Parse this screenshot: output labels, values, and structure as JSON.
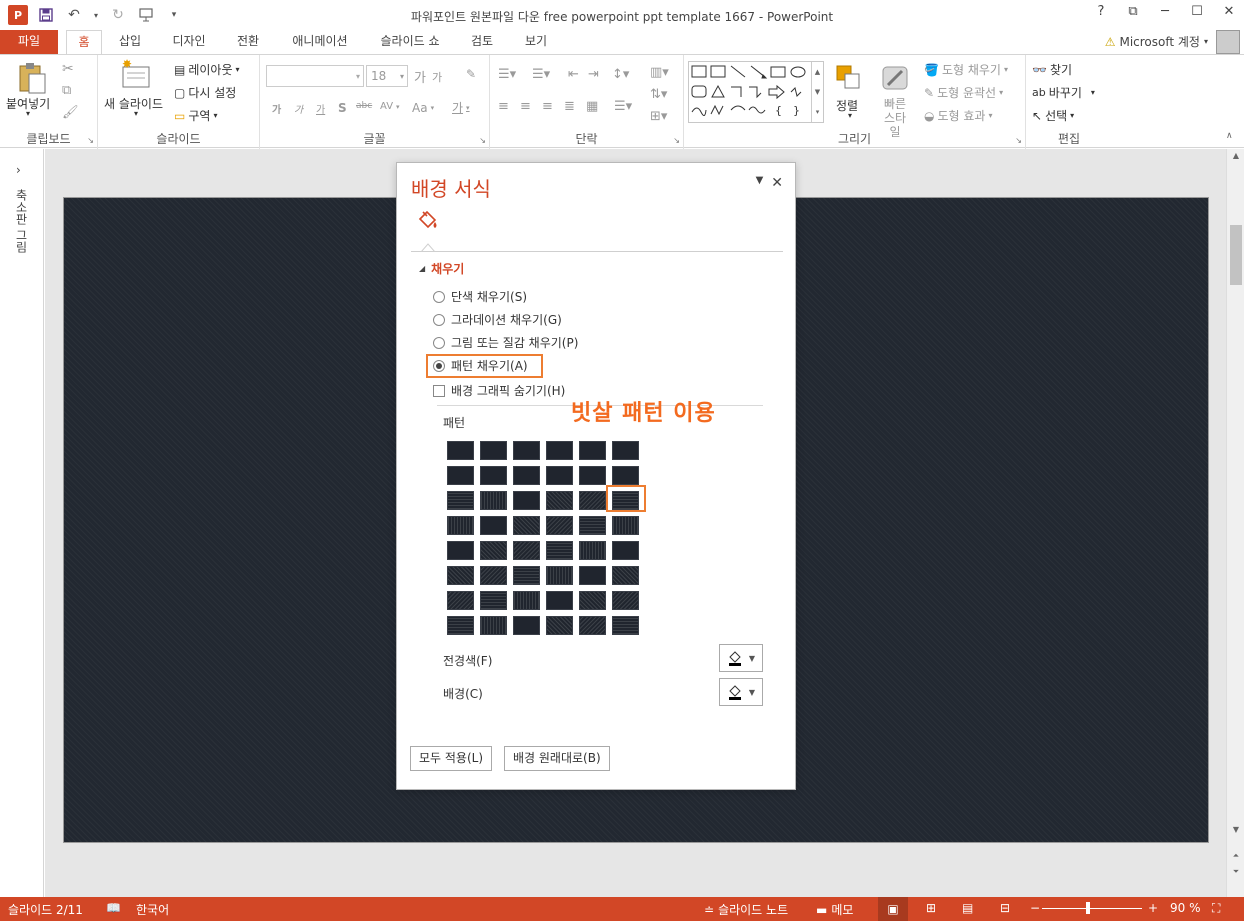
{
  "window": {
    "title": "파워포인트 원본파일 다운 free powerpoint ppt template 1667 - PowerPoint",
    "app_icon_letter": "P",
    "controls": [
      "?",
      "⧉",
      "─",
      "☐",
      "✕"
    ]
  },
  "tabs": {
    "file": "파일",
    "items": [
      "홈",
      "삽입",
      "디자인",
      "전환",
      "애니메이션",
      "슬라이드 쇼",
      "검토",
      "보기"
    ],
    "account": "Microsoft 계정"
  },
  "ribbon": {
    "clipboard": {
      "paste": "붙여넣기",
      "label": "클립보드"
    },
    "slides": {
      "new_slide": "새 슬라이드",
      "layout": "레이아웃",
      "reset": "다시 설정",
      "section": "구역",
      "label": "슬라이드"
    },
    "font": {
      "size": "18",
      "grow": "가",
      "shrink": "가",
      "bold": "가",
      "italic": "가",
      "underline": "가",
      "shadow": "S",
      "strike": "abc",
      "spacing": "AV",
      "case": "Aa",
      "color": "가",
      "label": "글꼴"
    },
    "paragraph": {
      "label": "단락"
    },
    "drawing": {
      "arrange": "정렬",
      "quick_styles": "빠른 스타일",
      "shape_fill": "도형 채우기",
      "shape_outline": "도형 윤곽선",
      "shape_effects": "도형 효과",
      "label": "그리기"
    },
    "editing": {
      "find": "찾기",
      "replace": "바꾸기",
      "select": "선택",
      "label": "편집"
    }
  },
  "leftbar": {
    "label": "축소판 그림"
  },
  "pane": {
    "title": "배경 서식",
    "section": "채우기",
    "options": [
      {
        "label": "단색 채우기(S)",
        "selected": false
      },
      {
        "label": "그라데이션 채우기(G)",
        "selected": false
      },
      {
        "label": "그림 또는 질감 채우기(P)",
        "selected": false
      },
      {
        "label": "패턴 채우기(A)",
        "selected": true
      }
    ],
    "hide_graphics": "배경 그래픽 숨기기(H)",
    "pattern_label": "패턴",
    "annotation": "빗살 패턴 이용",
    "foreground": "전경색(F)",
    "background": "배경(C)",
    "apply_all": "모두 적용(L)",
    "reset_bg": "배경 원래대로(B)",
    "accent": "#d24726",
    "highlight": "#ed7d31"
  },
  "status": {
    "slide": "슬라이드 2/11",
    "language": "한국어",
    "notes": "슬라이드 노트",
    "comments": "메모",
    "zoom": "90 %"
  }
}
